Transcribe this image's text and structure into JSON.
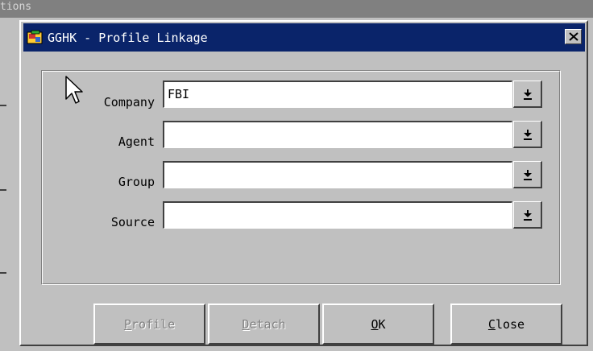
{
  "background_window": {
    "title_fragment": "tions"
  },
  "dialog": {
    "title": "GGHK - Profile Linkage",
    "fields": [
      {
        "label": "Company",
        "value": "FBI"
      },
      {
        "label": "Agent",
        "value": ""
      },
      {
        "label": "Group",
        "value": ""
      },
      {
        "label": "Source",
        "value": ""
      }
    ],
    "buttons": {
      "profile": {
        "mnemonic": "P",
        "rest": "rofile",
        "enabled": false
      },
      "detach": {
        "mnemonic": "D",
        "rest": "etach",
        "enabled": false
      },
      "ok": {
        "mnemonic": "O",
        "rest": "K",
        "enabled": true
      },
      "close": {
        "mnemonic": "C",
        "rest": "lose",
        "enabled": true
      }
    }
  },
  "icons": {
    "app": "app-icon",
    "close": "close-icon",
    "dropdown": "dropdown-arrow-icon",
    "cursor": "mouse-cursor-icon"
  },
  "colors": {
    "titlebar": "#0a246a",
    "face": "#c0c0c0",
    "disabled_text": "#808080"
  }
}
